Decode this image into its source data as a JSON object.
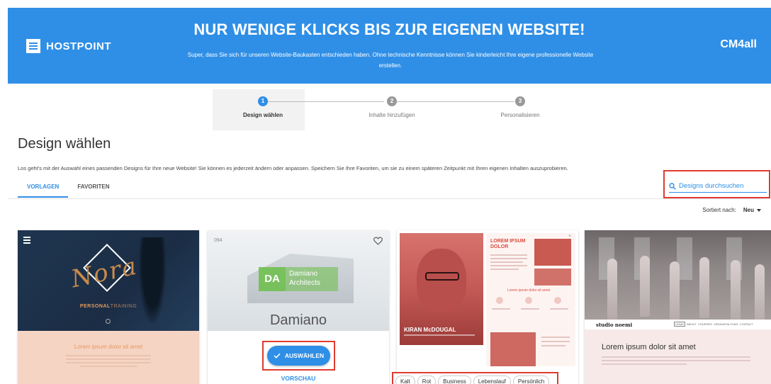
{
  "header": {
    "logo_text": "HOSTPOINT",
    "title": "NUR WENIGE KLICKS BIS ZUR EIGENEN WEBSITE!",
    "subtitle": "Super, dass Sie sich für unseren Website-Baukasten entschieden haben. Ohne technische Kenntnisse können Sie kinderleicht Ihre eigene professionelle Website erstellen.",
    "partner_logo": "CM4all"
  },
  "stepper": {
    "current_step": 1,
    "steps": [
      {
        "number": "1",
        "label": "Design wählen"
      },
      {
        "number": "2",
        "label": "Inhalte hinzufügen"
      },
      {
        "number": "3",
        "label": "Personalisieren"
      }
    ]
  },
  "page": {
    "title": "Design wählen",
    "intro": "Los geht's mit der Auswahl eines passenden Designs für Ihre neue Website! Sie können es jederzeit ändern oder anpassen. Speichern Sie Ihre Favoriten, um sie zu einem späteren Zeitpunkt mit Ihren eigenen Inhalten auszuprobieren."
  },
  "tabs": [
    {
      "label": "VORLAGEN",
      "active": true
    },
    {
      "label": "FAVORITEN",
      "active": false
    }
  ],
  "search": {
    "placeholder": "Designs durchsuchen",
    "icon": "search-icon"
  },
  "sort": {
    "label": "Sortiert nach:",
    "value": "Neu"
  },
  "cards": {
    "nora": {
      "script": "Nora",
      "label_bold": "PERSONAL",
      "label_light": "TRAINING",
      "lorem": "Lorem ipsum dolor sit amet"
    },
    "damiano": {
      "number": "094",
      "logo_initials": "DA",
      "logo_name": "Damiano Architects",
      "name": "Damiano",
      "select_button": "AUSWÄHLEN",
      "preview_link": "VORSCHAU"
    },
    "kiran": {
      "name": "KIRAN McDOUGAL",
      "heading": "LOREM IPSUM DOLOR",
      "subheading": "Lorem ipsum dolor sit amet"
    },
    "noemi": {
      "brand": "studio noemi",
      "nav_links": [
        "HOME",
        "ABOUT",
        "COURSES",
        "VERANSTALTUNG",
        "CONTACT"
      ],
      "lorem": "Lorem ipsum dolor sit amet"
    }
  },
  "filter_tags": [
    "Kalt",
    "Rot",
    "Business",
    "Lebenslauf",
    "Persönlich"
  ],
  "colors": {
    "brand_blue": "#2f8fe6",
    "highlight_red": "#e03a2f"
  }
}
